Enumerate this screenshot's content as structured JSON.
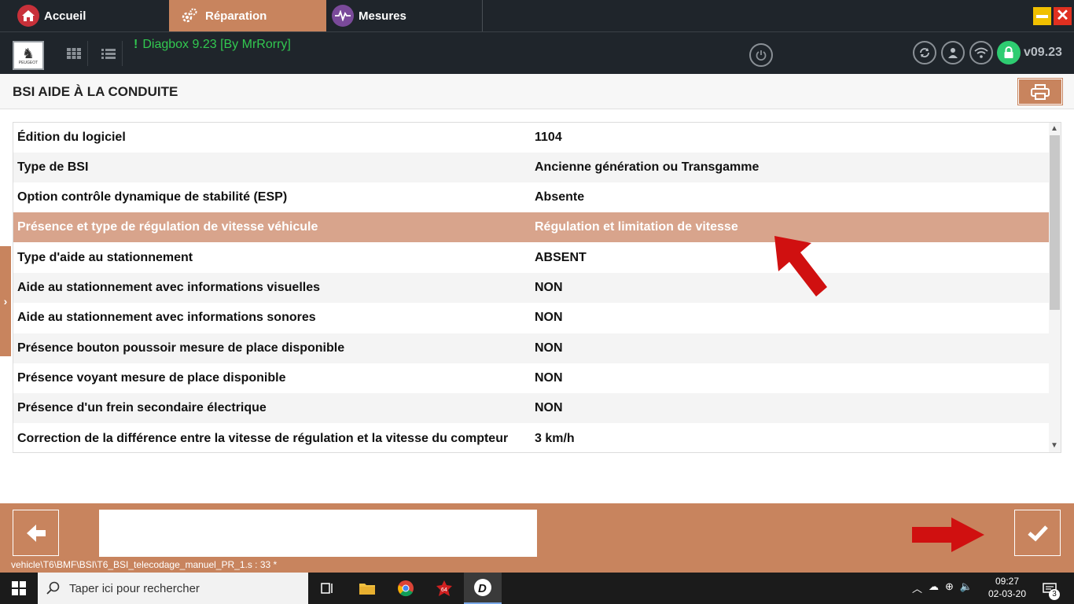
{
  "tabs": [
    {
      "label": "Accueil",
      "icon": "home-icon"
    },
    {
      "label": "Réparation",
      "icon": "gears-icon"
    },
    {
      "label": "Mesures",
      "icon": "pulse-icon"
    }
  ],
  "window": {
    "close_glyph": "✕"
  },
  "toolbar": {
    "app_title": "Diagbox 9.23 [By MrRorry]",
    "app_title_marker": "!",
    "version": "v09.23",
    "logo_text": "PEUGEOT"
  },
  "page": {
    "title": "BSI AIDE À LA CONDUITE"
  },
  "table": {
    "rows": [
      {
        "label": "Édition du logiciel",
        "value": "1104"
      },
      {
        "label": "Type de BSI",
        "value": "Ancienne génération ou Transgamme"
      },
      {
        "label": "Option contrôle dynamique de stabilité (ESP)",
        "value": "Absente"
      },
      {
        "label": "Présence et type de régulation de vitesse véhicule",
        "value": "Régulation et limitation de vitesse",
        "selected": true
      },
      {
        "label": "Type d'aide au stationnement",
        "value": "ABSENT"
      },
      {
        "label": "Aide au stationnement avec informations visuelles",
        "value": "NON"
      },
      {
        "label": "Aide au stationnement avec informations sonores",
        "value": "NON"
      },
      {
        "label": "Présence bouton poussoir mesure de place disponible",
        "value": "NON"
      },
      {
        "label": "Présence voyant mesure de place disponible",
        "value": "NON"
      },
      {
        "label": "Présence d'un frein secondaire électrique",
        "value": "NON"
      },
      {
        "label": "Correction de la différence entre la vitesse de régulation et la vitesse du compteur",
        "value": "3 km/h"
      }
    ]
  },
  "footer": {
    "status_path": "vehicle\\T6\\BMF\\BSI\\T6_BSI_telecodage_manuel_PR_1.s : 33 *"
  },
  "taskbar": {
    "search_placeholder": "Taper ici pour rechercher",
    "time": "09:27",
    "date": "02-03-20",
    "notification_count": "3"
  },
  "colors": {
    "accent": "#c8845e",
    "selected_row": "#d8a48c",
    "title_green": "#32c850",
    "annotation_red": "#d01010"
  }
}
